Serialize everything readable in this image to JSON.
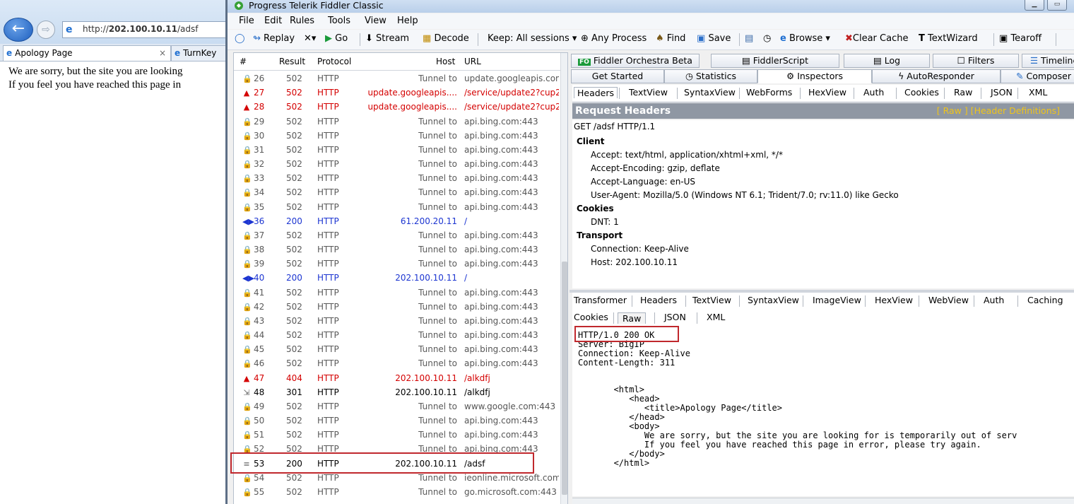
{
  "browser": {
    "url_host": "http://",
    "url_bold": "202.100.10.11",
    "url_rest": "/adsf",
    "tabs": [
      {
        "label": "Apology Page",
        "close": "×"
      },
      {
        "label": "TurnKey"
      }
    ],
    "content": [
      "We are sorry, but the site you are looking",
      "If you feel you have reached this page in"
    ]
  },
  "fiddler": {
    "title": "Progress Telerik Fiddler Classic",
    "menu": [
      "File",
      "Edit",
      "Rules",
      "Tools",
      "View",
      "Help"
    ],
    "toolbar": {
      "replay": "Replay",
      "remove": "✕▾",
      "go": "Go",
      "stream": "Stream",
      "decode": "Decode",
      "keep": "Keep: All sessions ▾",
      "process": "Any Process",
      "find": "Find",
      "save": "Save",
      "browse": "Browse ▾",
      "clear_cache": "Clear Cache",
      "textwizard": "TextWizard",
      "tearoff": "Tearoff"
    },
    "sessions": {
      "headers": {
        "num": "#",
        "result": "Result",
        "protocol": "Protocol",
        "host": "Host",
        "url": "URL"
      },
      "rows": [
        {
          "num": "26",
          "result": "502",
          "protocol": "HTTP",
          "host": "Tunnel to",
          "url": "update.googleapis.com",
          "style": "gray",
          "icon": "lock"
        },
        {
          "num": "27",
          "result": "502",
          "protocol": "HTTP",
          "host": "update.googleapis....",
          "url": "/service/update2?cup2",
          "style": "red",
          "icon": "warn"
        },
        {
          "num": "28",
          "result": "502",
          "protocol": "HTTP",
          "host": "update.googleapis....",
          "url": "/service/update2?cup2",
          "style": "red",
          "icon": "warn"
        },
        {
          "num": "29",
          "result": "502",
          "protocol": "HTTP",
          "host": "Tunnel to",
          "url": "api.bing.com:443",
          "style": "gray",
          "icon": "lock"
        },
        {
          "num": "30",
          "result": "502",
          "protocol": "HTTP",
          "host": "Tunnel to",
          "url": "api.bing.com:443",
          "style": "gray",
          "icon": "lock"
        },
        {
          "num": "31",
          "result": "502",
          "protocol": "HTTP",
          "host": "Tunnel to",
          "url": "api.bing.com:443",
          "style": "gray",
          "icon": "lock"
        },
        {
          "num": "32",
          "result": "502",
          "protocol": "HTTP",
          "host": "Tunnel to",
          "url": "api.bing.com:443",
          "style": "gray",
          "icon": "lock"
        },
        {
          "num": "33",
          "result": "502",
          "protocol": "HTTP",
          "host": "Tunnel to",
          "url": "api.bing.com:443",
          "style": "gray",
          "icon": "lock"
        },
        {
          "num": "34",
          "result": "502",
          "protocol": "HTTP",
          "host": "Tunnel to",
          "url": "api.bing.com:443",
          "style": "gray",
          "icon": "lock"
        },
        {
          "num": "35",
          "result": "502",
          "protocol": "HTTP",
          "host": "Tunnel to",
          "url": "api.bing.com:443",
          "style": "gray",
          "icon": "lock"
        },
        {
          "num": "36",
          "result": "200",
          "protocol": "HTTP",
          "host": "61.200.20.11",
          "url": "/",
          "style": "blue",
          "icon": "arrows"
        },
        {
          "num": "37",
          "result": "502",
          "protocol": "HTTP",
          "host": "Tunnel to",
          "url": "api.bing.com:443",
          "style": "gray",
          "icon": "lock"
        },
        {
          "num": "38",
          "result": "502",
          "protocol": "HTTP",
          "host": "Tunnel to",
          "url": "api.bing.com:443",
          "style": "gray",
          "icon": "lock"
        },
        {
          "num": "39",
          "result": "502",
          "protocol": "HTTP",
          "host": "Tunnel to",
          "url": "api.bing.com:443",
          "style": "gray",
          "icon": "lock"
        },
        {
          "num": "40",
          "result": "200",
          "protocol": "HTTP",
          "host": "202.100.10.11",
          "url": "/",
          "style": "blue",
          "icon": "arrows"
        },
        {
          "num": "41",
          "result": "502",
          "protocol": "HTTP",
          "host": "Tunnel to",
          "url": "api.bing.com:443",
          "style": "gray",
          "icon": "lock"
        },
        {
          "num": "42",
          "result": "502",
          "protocol": "HTTP",
          "host": "Tunnel to",
          "url": "api.bing.com:443",
          "style": "gray",
          "icon": "lock"
        },
        {
          "num": "43",
          "result": "502",
          "protocol": "HTTP",
          "host": "Tunnel to",
          "url": "api.bing.com:443",
          "style": "gray",
          "icon": "lock"
        },
        {
          "num": "44",
          "result": "502",
          "protocol": "HTTP",
          "host": "Tunnel to",
          "url": "api.bing.com:443",
          "style": "gray",
          "icon": "lock"
        },
        {
          "num": "45",
          "result": "502",
          "protocol": "HTTP",
          "host": "Tunnel to",
          "url": "api.bing.com:443",
          "style": "gray",
          "icon": "lock"
        },
        {
          "num": "46",
          "result": "502",
          "protocol": "HTTP",
          "host": "Tunnel to",
          "url": "api.bing.com:443",
          "style": "gray",
          "icon": "lock"
        },
        {
          "num": "47",
          "result": "404",
          "protocol": "HTTP",
          "host": "202.100.10.11",
          "url": "/alkdfj",
          "style": "red",
          "icon": "warn"
        },
        {
          "num": "48",
          "result": "301",
          "protocol": "HTTP",
          "host": "202.100.10.11",
          "url": "/alkdfj",
          "style": "black",
          "icon": "redirect"
        },
        {
          "num": "49",
          "result": "502",
          "protocol": "HTTP",
          "host": "Tunnel to",
          "url": "www.google.com:443",
          "style": "gray",
          "icon": "lock"
        },
        {
          "num": "50",
          "result": "502",
          "protocol": "HTTP",
          "host": "Tunnel to",
          "url": "api.bing.com:443",
          "style": "gray",
          "icon": "lock"
        },
        {
          "num": "51",
          "result": "502",
          "protocol": "HTTP",
          "host": "Tunnel to",
          "url": "api.bing.com:443",
          "style": "gray",
          "icon": "lock"
        },
        {
          "num": "52",
          "result": "502",
          "protocol": "HTTP",
          "host": "Tunnel to",
          "url": "api.bing.com:443",
          "style": "gray",
          "icon": "lock"
        },
        {
          "num": "53",
          "result": "200",
          "protocol": "HTTP",
          "host": "202.100.10.11",
          "url": "/adsf",
          "style": "black",
          "icon": "doc"
        },
        {
          "num": "54",
          "result": "502",
          "protocol": "HTTP",
          "host": "Tunnel to",
          "url": "ieonline.microsoft.com",
          "style": "gray",
          "icon": "lock"
        },
        {
          "num": "55",
          "result": "502",
          "protocol": "HTTP",
          "host": "Tunnel to",
          "url": "go.microsoft.com:443",
          "style": "gray",
          "icon": "lock"
        }
      ]
    },
    "top_tabs_row1": [
      "Fiddler Orchestra Beta",
      "FiddlerScript",
      "Log",
      "Filters",
      "Timeline"
    ],
    "top_tabs_row2": [
      "Get Started",
      "Statistics",
      "Inspectors",
      "AutoResponder",
      "Composer"
    ],
    "request_tabs": [
      "Headers",
      "TextView",
      "SyntaxView",
      "WebForms",
      "HexView",
      "Auth",
      "Cookies",
      "Raw",
      "JSON",
      "XML"
    ],
    "request_headers": {
      "title": "Request Headers",
      "links": "[ Raw ]   [Header Definitions]",
      "request_line": "GET /adsf HTTP/1.1",
      "groups": [
        {
          "name": "Client",
          "items": [
            "Accept: text/html, application/xhtml+xml, */*",
            "Accept-Encoding: gzip, deflate",
            "Accept-Language: en-US",
            "User-Agent: Mozilla/5.0 (Windows NT 6.1; Trident/7.0; rv:11.0) like Gecko"
          ]
        },
        {
          "name": "Cookies",
          "items": [
            "DNT: 1"
          ]
        },
        {
          "name": "Transport",
          "items": [
            "Connection: Keep-Alive",
            "Host: 202.100.10.11"
          ]
        }
      ]
    },
    "response_tabs": [
      "Transformer",
      "Headers",
      "TextView",
      "SyntaxView",
      "ImageView",
      "HexView",
      "WebView",
      "Auth",
      "Caching"
    ],
    "response_subtabs": [
      "Cookies",
      "Raw",
      "JSON",
      "XML"
    ],
    "response_body": [
      "HTTP/1.0 200 OK",
      "Server: BigIP",
      "Connection: Keep-Alive",
      "Content-Length: 311",
      "",
      "",
      "       <html>",
      "          <head>",
      "             <title>Apology Page</title>",
      "          </head>",
      "          <body>",
      "             We are sorry, but the site you are looking for is temporarily out of serv",
      "             If you feel you have reached this page in error, please try again.",
      "          </body>",
      "       </html>"
    ],
    "colors": {
      "red": "#d40000",
      "blue": "#1c35d1",
      "highlight": "#c0282d",
      "header_bar": "#8f97a3"
    }
  }
}
